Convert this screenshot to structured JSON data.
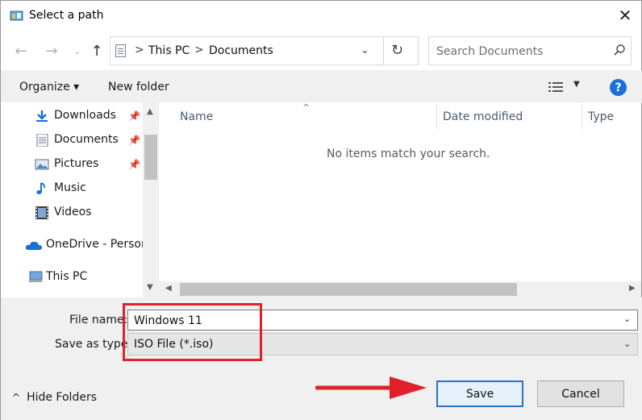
{
  "window": {
    "title": "Select a path",
    "close_label": "✕"
  },
  "address_bar": {
    "crumbs": [
      "This PC",
      "Documents"
    ],
    "separator": ">"
  },
  "search": {
    "placeholder": "Search Documents"
  },
  "command_bar": {
    "organize_label": "Organize ▾",
    "new_folder_label": "New folder",
    "help_label": "?"
  },
  "nav_pane": {
    "items": [
      {
        "label": "Downloads",
        "icon": "download-icon",
        "pinned": true
      },
      {
        "label": "Documents",
        "icon": "document-icon",
        "pinned": true
      },
      {
        "label": "Pictures",
        "icon": "pictures-icon",
        "pinned": true
      },
      {
        "label": "Music",
        "icon": "music-icon",
        "pinned": false
      },
      {
        "label": "Videos",
        "icon": "videos-icon",
        "pinned": false
      },
      {
        "label": "OneDrive - Person",
        "icon": "onedrive-icon",
        "pinned": false
      },
      {
        "label": "This PC",
        "icon": "computer-icon",
        "pinned": false
      }
    ]
  },
  "file_list": {
    "columns": [
      "Name",
      "Date modified",
      "Type"
    ],
    "empty_message": "No items match your search."
  },
  "form": {
    "file_name_label": "File name:",
    "file_name_value": "Windows 11",
    "save_as_type_label": "Save as type:",
    "save_as_type_value": "ISO File (*.iso)"
  },
  "footer": {
    "hide_folders_label": "Hide Folders",
    "save_label": "Save",
    "cancel_label": "Cancel"
  },
  "colors": {
    "accent": "#1d6fd8",
    "annotation_red": "#e0202a",
    "panel_bg": "#f0f0f0"
  }
}
